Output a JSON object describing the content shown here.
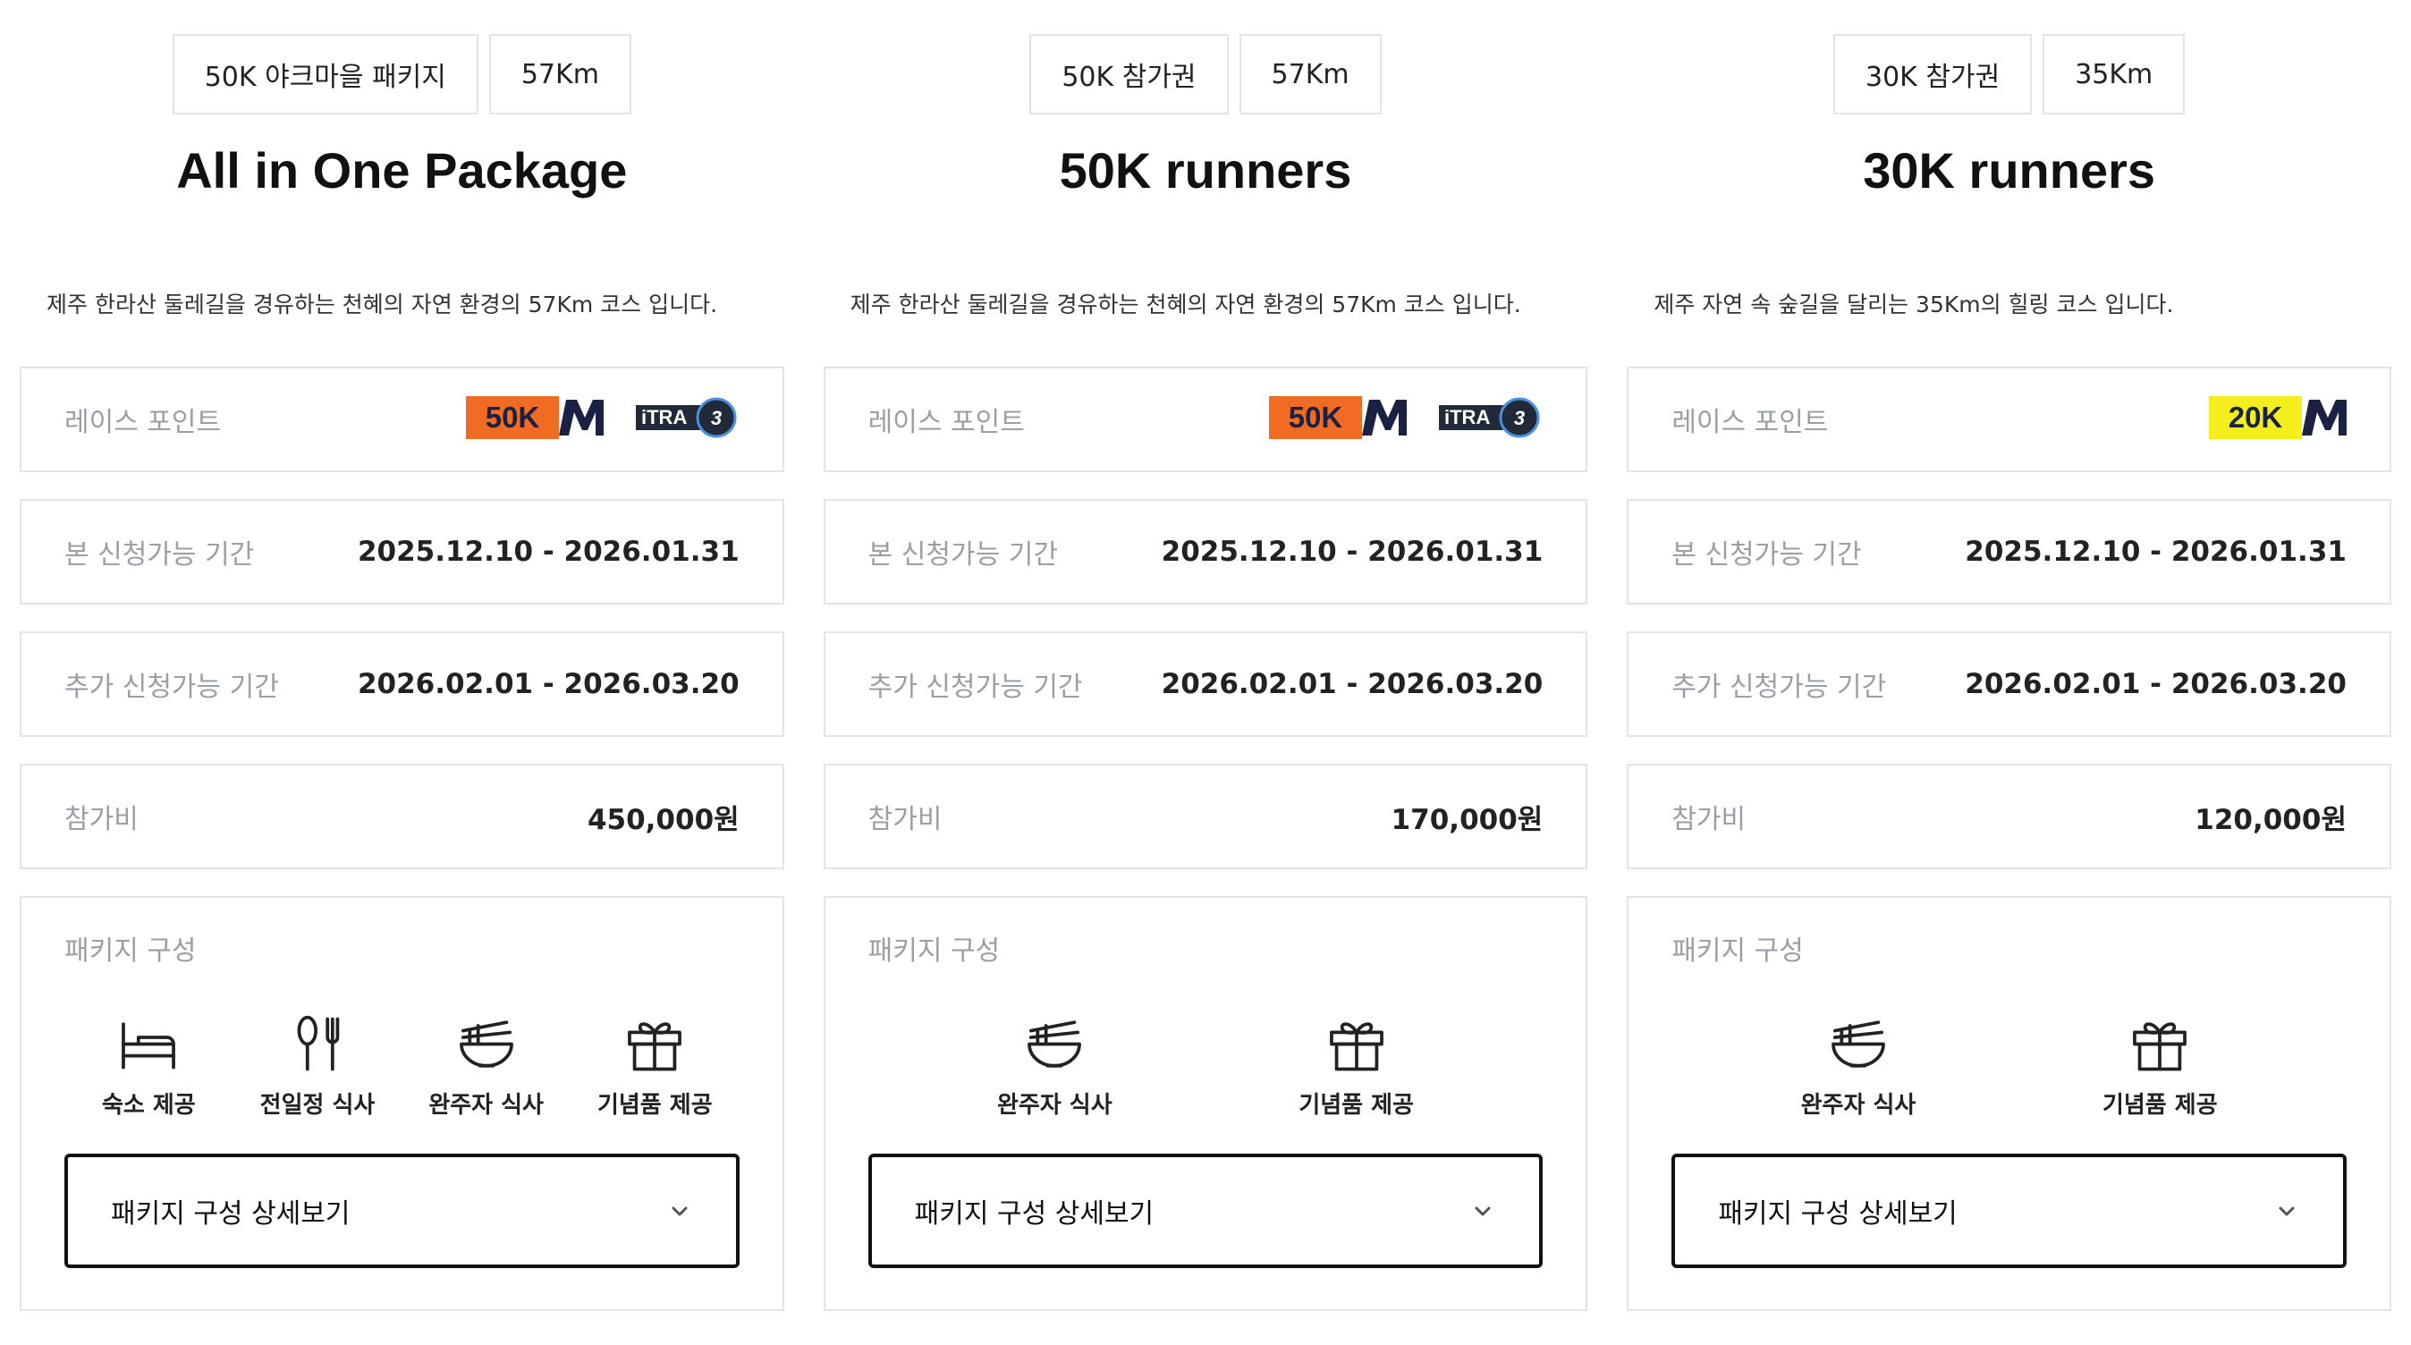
{
  "columns": [
    {
      "tags": [
        "50K 야크마을 패키지",
        "57Km"
      ],
      "title": "All in One Package",
      "description": "제주 한라산 둘레길을 경유하는 천혜의 자연 환경의 57Km 코스 입니다.",
      "race_point_label": "레이스 포인트",
      "race_badges": [
        {
          "text": "50K",
          "color": "#f26b22"
        },
        {
          "text": "ITRA 3",
          "color": "#222a3a"
        }
      ],
      "main_period_label": "본 신청가능 기간",
      "main_period": "2025.12.10 - 2026.01.31",
      "extra_period_label": "추가 신청가능 기간",
      "extra_period": "2026.02.01 - 2026.03.20",
      "fee_label": "참가비",
      "fee": "450,000원",
      "package_label": "패키지 구성",
      "package_items": [
        {
          "icon": "bed-icon",
          "label": "숙소 제공"
        },
        {
          "icon": "utensils-icon",
          "label": "전일정 식사"
        },
        {
          "icon": "noodle-bowl-icon",
          "label": "완주자 식사"
        },
        {
          "icon": "gift-icon",
          "label": "기념품 제공"
        }
      ],
      "dropdown_label": "패키지 구성 상세보기"
    },
    {
      "tags": [
        "50K 참가권",
        "57Km"
      ],
      "title": "50K runners",
      "description": "제주 한라산 둘레길을 경유하는 천혜의 자연 환경의 57Km 코스 입니다.",
      "race_point_label": "레이스 포인트",
      "race_badges": [
        {
          "text": "50K",
          "color": "#f26b22"
        },
        {
          "text": "ITRA 3",
          "color": "#222a3a"
        }
      ],
      "main_period_label": "본 신청가능 기간",
      "main_period": "2025.12.10 - 2026.01.31",
      "extra_period_label": "추가 신청가능 기간",
      "extra_period": "2026.02.01 - 2026.03.20",
      "fee_label": "참가비",
      "fee": "170,000원",
      "package_label": "패키지 구성",
      "package_items": [
        {
          "icon": "noodle-bowl-icon",
          "label": "완주자 식사"
        },
        {
          "icon": "gift-icon",
          "label": "기념품 제공"
        }
      ],
      "dropdown_label": "패키지 구성 상세보기"
    },
    {
      "tags": [
        "30K 참가권",
        "35Km"
      ],
      "title": "30K runners",
      "description": "제주 자연 속 숲길을 달리는 35Km의 힐링 코스 입니다.",
      "race_point_label": "레이스 포인트",
      "race_badges": [
        {
          "text": "20K",
          "color": "#f4ee1c"
        }
      ],
      "main_period_label": "본 신청가능 기간",
      "main_period": "2025.12.10 - 2026.01.31",
      "extra_period_label": "추가 신청가능 기간",
      "extra_period": "2026.02.01 - 2026.03.20",
      "fee_label": "참가비",
      "fee": "120,000원",
      "package_label": "패키지 구성",
      "package_items": [
        {
          "icon": "noodle-bowl-icon",
          "label": "완주자 식사"
        },
        {
          "icon": "gift-icon",
          "label": "기념품 제공"
        }
      ],
      "dropdown_label": "패키지 구성 상세보기"
    }
  ]
}
